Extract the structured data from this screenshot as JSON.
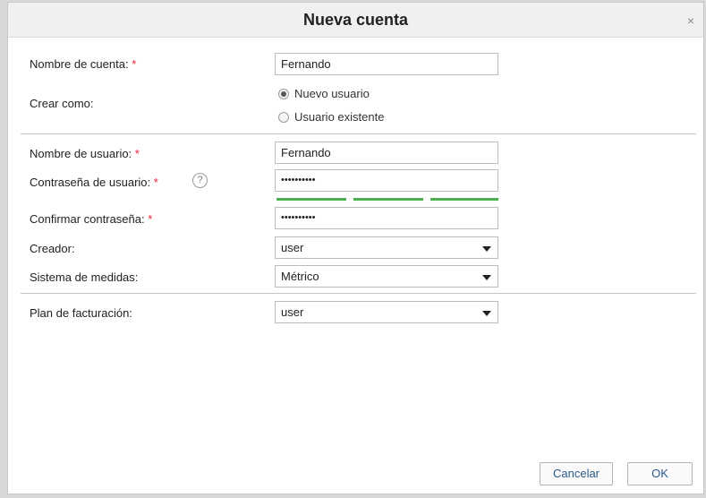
{
  "dialog": {
    "title": "Nueva cuenta",
    "close_glyph": "×"
  },
  "form": {
    "account_name": {
      "label": "Nombre de cuenta:",
      "required_mark": "*",
      "value": "Fernando"
    },
    "create_as": {
      "label": "Crear como:",
      "options": [
        {
          "label": "Nuevo usuario",
          "selected": true
        },
        {
          "label": "Usuario existente",
          "selected": false
        }
      ]
    },
    "username": {
      "label": "Nombre de usuario:",
      "required_mark": "*",
      "value": "Fernando"
    },
    "password": {
      "label": "Contraseña de usuario:",
      "required_mark": "*",
      "help_glyph": "?",
      "value": "••••••••••",
      "strength_segments": 3
    },
    "confirm_password": {
      "label": "Confirmar contraseña:",
      "required_mark": "*",
      "value": "••••••••••"
    },
    "creator": {
      "label": "Creador:",
      "value": "user"
    },
    "measure_system": {
      "label": "Sistema de medidas:",
      "value": "Métrico"
    },
    "billing_plan": {
      "label": "Plan de facturación:",
      "value": "user"
    }
  },
  "buttons": {
    "cancel": "Cancelar",
    "ok": "OK"
  },
  "colors": {
    "required": "#e23333",
    "strength_bar": "#4caf50",
    "button_text": "#2a5a8a"
  }
}
